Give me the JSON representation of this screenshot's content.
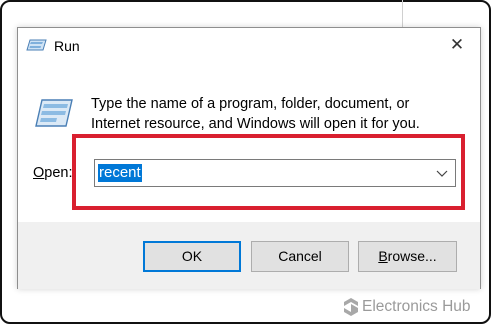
{
  "window": {
    "title": "Run",
    "close_glyph": "✕"
  },
  "body": {
    "description": "Type the name of a program, folder, document, or Internet resource, and Windows will open it for you."
  },
  "open_field": {
    "label_prefix": "O",
    "label_rest": "pen:",
    "value": "recent"
  },
  "buttons": {
    "ok": "OK",
    "cancel": "Cancel",
    "browse_prefix": "B",
    "browse_rest": "rowse..."
  },
  "watermark": {
    "brand": "Electronics Hub"
  },
  "icons": {
    "title": "run-icon",
    "dialog": "run-icon",
    "dropdown": "chevron-down-icon",
    "watermark": "electronics-hub-logo"
  },
  "colors": {
    "highlight": "#d9202f",
    "selection": "#0078d7",
    "ok_border": "#0078d7"
  }
}
